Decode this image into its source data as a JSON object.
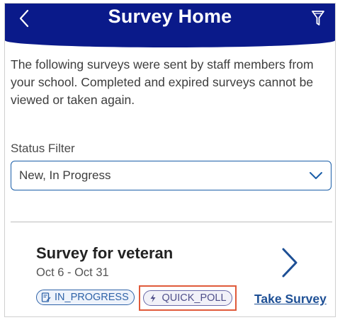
{
  "header": {
    "title": "Survey Home"
  },
  "intro": {
    "text": "The following surveys were sent by staff members from your school. Completed and expired surveys cannot be viewed or taken again."
  },
  "filter": {
    "label": "Status Filter",
    "selected": "New, In Progress"
  },
  "surveys": [
    {
      "title": "Survey for veteran",
      "dates": "Oct 6 - Oct 31",
      "status_badge": "IN_PROGRESS",
      "type_badge": "QUICK_POLL",
      "action_label": "Take Survey"
    }
  ],
  "icons": {
    "back": "chevron-left-icon",
    "filter": "funnel-icon",
    "dropdown": "chevron-down-icon",
    "open": "chevron-right-icon",
    "status": "edit-document-icon",
    "poll": "lightning-icon"
  },
  "colors": {
    "header_bg": "#0a1a8a",
    "accent": "#1d4f95",
    "highlight": "#e05a3a"
  }
}
